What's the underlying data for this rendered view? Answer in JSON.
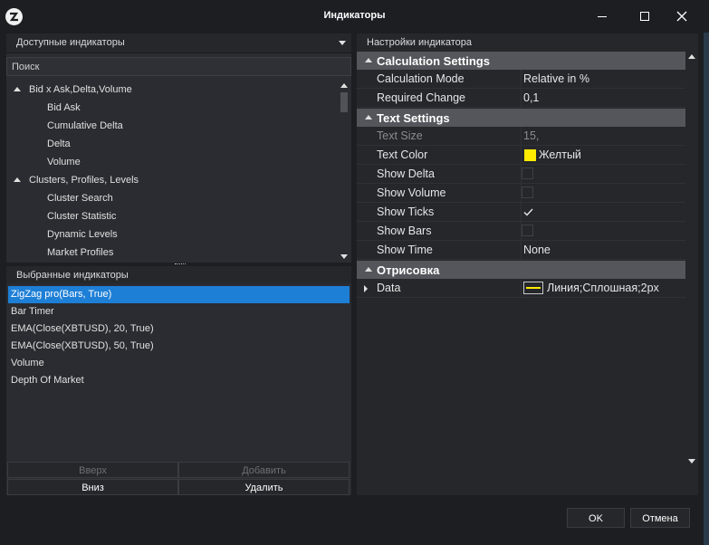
{
  "window": {
    "title": "Индикаторы"
  },
  "left": {
    "dropdown_label": "Доступные индикаторы",
    "search_placeholder": "Поиск",
    "tree": [
      {
        "label": "Bid x Ask,Delta,Volume",
        "level": 0
      },
      {
        "label": "Bid Ask",
        "level": 1
      },
      {
        "label": "Cumulative Delta",
        "level": 1
      },
      {
        "label": "Delta",
        "level": 1
      },
      {
        "label": "Volume",
        "level": 1
      },
      {
        "label": "Clusters, Profiles, Levels",
        "level": 0
      },
      {
        "label": "Cluster Search",
        "level": 1
      },
      {
        "label": "Cluster Statistic",
        "level": 1
      },
      {
        "label": "Dynamic Levels",
        "level": 1
      },
      {
        "label": "Market Profiles",
        "level": 1
      }
    ],
    "selected_header": "Выбранные индикаторы",
    "selected": [
      {
        "label": "ZigZag pro(Bars, True)",
        "active": true
      },
      {
        "label": "Bar Timer"
      },
      {
        "label": "EMA(Close(XBTUSD), 20, True)"
      },
      {
        "label": "EMA(Close(XBTUSD), 50, True)"
      },
      {
        "label": "Volume"
      },
      {
        "label": "Depth Of Market"
      }
    ],
    "buttons": {
      "up": "Вверх",
      "add": "Добавить",
      "down": "Вниз",
      "delete": "Удалить"
    }
  },
  "right": {
    "header": "Настройки индикатора",
    "categories": {
      "calc": "Calculation Settings",
      "text": "Text Settings",
      "draw": "Отрисовка"
    },
    "props": {
      "calc_mode": {
        "key": "Calculation Mode",
        "value": "Relative in %"
      },
      "req_change": {
        "key": "Required Change",
        "value": "0,1"
      },
      "text_size": {
        "key": "Text Size",
        "value": "15,"
      },
      "text_color": {
        "key": "Text Color",
        "value": "Желтый",
        "color": "#ffec00"
      },
      "show_delta": {
        "key": "Show Delta",
        "checked": false
      },
      "show_volume": {
        "key": "Show Volume",
        "checked": false
      },
      "show_ticks": {
        "key": "Show Ticks",
        "checked": true
      },
      "show_bars": {
        "key": "Show Bars",
        "checked": false
      },
      "show_time": {
        "key": "Show Time",
        "value": "None"
      },
      "data": {
        "key": "Data",
        "value": "Линия;Сплошная;2px",
        "color": "#ffec00"
      }
    }
  },
  "footer": {
    "ok": "OK",
    "cancel": "Отмена"
  },
  "colors": {
    "accent": "#1e7fd6",
    "background": "#1c1e22",
    "category": "#54565b"
  }
}
